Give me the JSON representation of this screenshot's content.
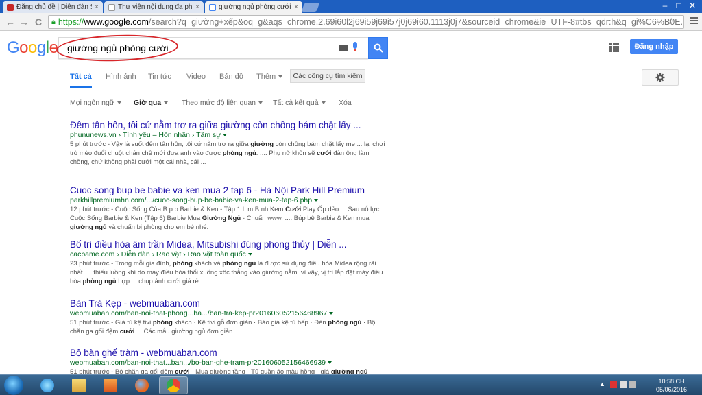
{
  "browser": {
    "tabs": [
      {
        "label": "Đăng chủ đề | Diễn đàn SI",
        "icon": "forum-favicon-icon"
      },
      {
        "label": "Thư viện nội dung đa phư",
        "icon": "page-favicon-icon"
      },
      {
        "label": "giường ngủ phòng cưới",
        "icon": "google-favicon-icon"
      }
    ],
    "close_glyph": "×",
    "back_glyph": "←",
    "forward_glyph": "→",
    "reload_glyph": "C",
    "min_glyph": "–",
    "max_glyph": "□",
    "close_window_glyph": "✕",
    "url": {
      "scheme": "https://",
      "host": "www.google.com",
      "rest": "/search?q=giường+xếp&oq=g&aqs=chrome.2.69i60l2j69i59j69i57j0j69i60.1113j0j7&sourceid=chrome&ie=UTF-8#tbs=qdr:h&q=gi%C6%B0E..."
    },
    "star_glyph": "☆"
  },
  "google": {
    "logo": [
      "G",
      "o",
      "o",
      "g",
      "l",
      "e"
    ],
    "logo_colors": [
      "#4285f4",
      "#ea4335",
      "#fbbc05",
      "#4285f4",
      "#34a853",
      "#ea4335"
    ],
    "query": "giường ngủ phòng cưới",
    "signin_label": "Đăng nhập",
    "tabs": [
      "Tất cả",
      "Hình ảnh",
      "Tin tức",
      "Video",
      "Bản đồ",
      "Thêm"
    ],
    "tools_label": "Các công cụ tìm kiếm",
    "filters": [
      "Mọi ngôn ngữ",
      "Giờ qua",
      "Theo mức độ liên quan",
      "Tất cả kết quả",
      "Xóa"
    ],
    "results": [
      {
        "title": "Đêm tân hôn, tôi cứ nằm trơ ra giữa giường còn chồng bám chặt lấy ...",
        "url": "phununews.vn › Tình yêu – Hôn nhân › Tâm sự",
        "snippet_a": "5 phút trước - Vậy là suốt đêm tân hôn, tôi cứ nằm trơ ra giữa ",
        "snippet_b1": "giường",
        "snippet_c": " còn chồng bám chặt lấy me ... lại chơi trò mèo đuổi chuột chán chê mới đưa anh vào được ",
        "snippet_b2": "phòng ngủ",
        "snippet_d": ". .... Phụ nữ khôn sẽ ",
        "snippet_b3": "cưới",
        "snippet_e": " đàn ông làm chồng, chứ không phải cưới một cái nhà, cái ..."
      },
      {
        "title": "Cuoc song bup be babie va ken mua 2 tap 6 - Hà Nội Park Hill Premium",
        "url": "parkhillpremiumhn.com/.../cuoc-song-bup-be-babie-va-ken-mua-2-tap-6.php",
        "snippet_a": "12 phút trước - Cuộc Sống Của B p b Barbie & Ken - Tập 1 L m B nh Kem ",
        "snippet_b1": "Cưới",
        "snippet_c": " Play Ốp dẻo ... Sau nỗ lực Cuộc Sống Barbie & Ken (Tập 6) Barbie Mua ",
        "snippet_b2": "Giường Ngủ",
        "snippet_d": " - Chuẩn www. .... Búp bê Barbie & Ken mua ",
        "snippet_b3": "giường ngủ",
        "snippet_e": " và chuẩn bị phòng cho em bé nhé."
      },
      {
        "title": "Bố trí điều hòa âm trần Midea, Mitsubishi đúng phong thủy | Diễn ...",
        "url": "cacbame.com › Diễn đàn › Rao vặt › Rao vặt toàn quốc",
        "snippet_a": "23 phút trước - Trong mỗi gia đình, ",
        "snippet_b1": "phòng",
        "snippet_c": " khách và ",
        "snippet_b2": "phòng ngủ",
        "snippet_d": " là được sử dụng điều hòa Midea rộng rãi nhất. ... thiếu luồng khí do máy điều hòa thổi xuống xốc thẳng vào giường nằm. vì vậy, vị trí lắp đặt máy điều hòa ",
        "snippet_b3": "phòng ngủ",
        "snippet_e": " hợp ... chụp ảnh cưới giá rẻ"
      },
      {
        "title": "Bàn Trà Kẹp - webmuaban.com",
        "url": "webmuaban.com/ban-noi-that-phong...ha.../ban-tra-kep-pr20160605215646896​7",
        "snippet_a": "51 phút trước - Giá tủ kệ tivi ",
        "snippet_b1": "phòng",
        "snippet_c": " khách · Kệ tivi gỗ đơn giản · Báo giá kệ tủ bếp · Đèn ",
        "snippet_b2": "phòng ngủ",
        "snippet_d": " · Bộ chăn ga gối đệm ",
        "snippet_b3": "cưới",
        "snippet_e": " ... Các mẫu giường ngủ đơn giản ..."
      },
      {
        "title": "Bộ bàn ghế tràm - webmuaban.com",
        "url": "webmuaban.com/ban-noi-that...ban.../bo-ban-ghe-tram-pr20160605215646693​9",
        "snippet_a": "51 phút trước - Bộ chăn ga gối đệm ",
        "snippet_b1": "cưới",
        "snippet_c": " · Mua giường tầng · Tủ quần áo màu hồng · giá ",
        "snippet_b2": "giường ngủ",
        "snippet_d": "",
        "snippet_b3": "",
        "snippet_e": ""
      }
    ]
  },
  "taskbar": {
    "time": "10:58 CH",
    "date": "05/06/2016",
    "tray_arrow": "▲"
  }
}
